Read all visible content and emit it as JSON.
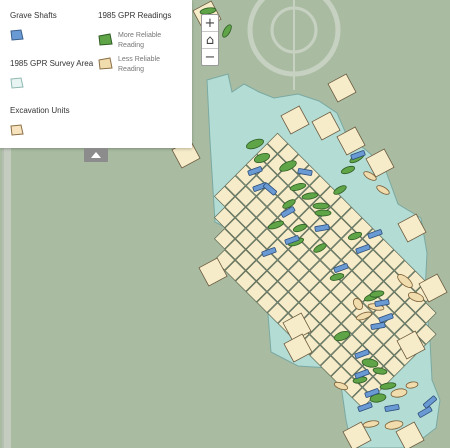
{
  "legend": {
    "grave_shafts_title": "Grave Shafts",
    "survey_area_title": "1985 GPR Survey Area",
    "excavation_title": "Excavation Units",
    "gpr_title": "1985 GPR Readings",
    "more_reliable_label": "More Reliable Reading",
    "less_reliable_label": "Less Reliable Reading"
  },
  "controls": {
    "zoom_in": "+",
    "home": "⌂",
    "zoom_out": "−"
  },
  "colors": {
    "background": "#a9bca2",
    "survey_area": "#b3dcd5",
    "grave_shafts": "#6a9ad4",
    "more_reliable": "#5fa548",
    "less_reliable": "#f1dcae",
    "excavation_units": "#f7ecc9"
  },
  "icons": [
    "zoom-in-icon",
    "home-icon",
    "zoom-out-icon",
    "collapse-up-icon"
  ]
}
